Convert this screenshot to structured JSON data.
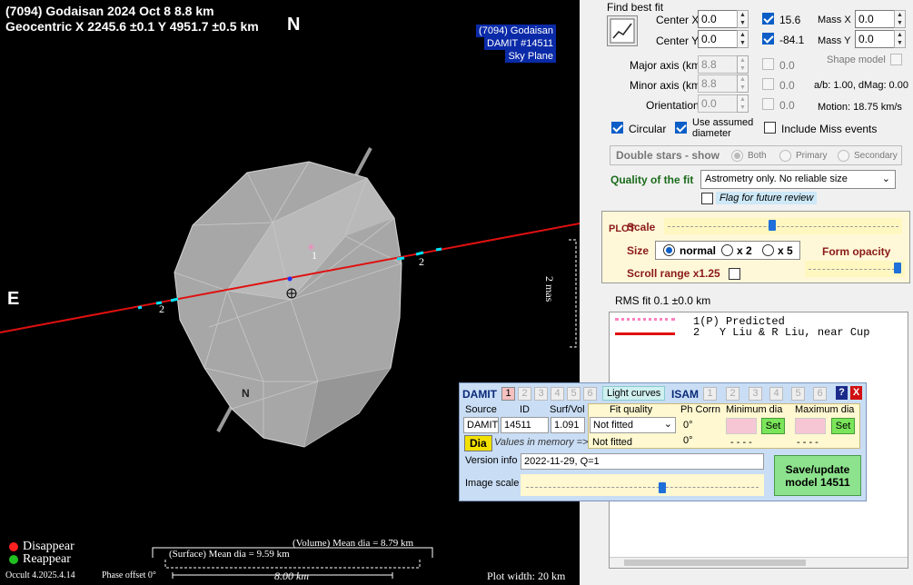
{
  "plot": {
    "title_line1": "(7094) Godaisan  2024 Oct 8   8.8 km",
    "title_line2": "Geocentric  X  2245.6 ±0.1  Y 4951.7 ±0.5 km",
    "north_label": "N",
    "east_label": "E",
    "info_name": "(7094) Godaisan",
    "info_model": "DAMIT #14511",
    "info_plane": "Sky Plane",
    "chord_label_1": "1",
    "chord_label_2a": "2",
    "chord_label_2b": "2",
    "pole_label": "N",
    "mas_label": "2 mas",
    "legend_disappear": "Disappear",
    "legend_reappear": "Reappear",
    "version": "Occult 4.2025.4.14",
    "phase_offset": "Phase offset 0°",
    "volume_mean": "(Volume) Mean dia = 8.79 km",
    "surface_mean": "(Surface) Mean dia = 9.59 km",
    "scale_bar": "8.00 km",
    "plot_width": "Plot width: 20 km",
    "colors": {
      "chord": "#e01010",
      "disappear": "#ff2020",
      "reappear": "#20c020",
      "marker": "#00e5ff"
    }
  },
  "panel": {
    "find_best_fit": "Find best fit",
    "fit_icon": "chart-fit-icon",
    "center_x_label": "Center X",
    "center_x_value": "0.0",
    "center_x_fit": "15.6",
    "center_y_label": "Center Y",
    "center_y_value": "0.0",
    "center_y_fit": "-84.1",
    "mass_x_label": "Mass X",
    "mass_x_value": "0.0",
    "mass_y_label": "Mass Y",
    "mass_y_value": "0.0",
    "shape_model_label": "Shape model",
    "major_axis_label": "Major axis (km)",
    "major_axis_value": "8.8",
    "major_axis_fit": "0.0",
    "minor_axis_label": "Minor axis (km)",
    "minor_axis_value": "8.8",
    "minor_axis_fit": "0.0",
    "ab_dmag": "a/b: 1.00, dMag: 0.00",
    "orientation_label": "Orientation",
    "orientation_value": "0.0",
    "orientation_fit": "0.0",
    "motion": "Motion: 18.75 km/s",
    "circular_label": "Circular",
    "use_assumed_label_1": "Use assumed",
    "use_assumed_label_2": "diameter",
    "include_miss_label": "Include Miss events",
    "double_stars_label": "Double stars - show",
    "ds_both": "Both",
    "ds_primary": "Primary",
    "ds_secondary": "Secondary",
    "quality_label": "Quality of the fit",
    "quality_value": "Astrometry only. No reliable size",
    "flag_label": "Flag for future review",
    "plot_vertical": "PLOT",
    "scale_label": "Scale",
    "size_label": "Size",
    "size_normal": "normal",
    "size_x2": "x 2",
    "size_x5": "x 5",
    "form_opacity_label": "Form opacity",
    "scroll_range_label": "Scroll range x1.25",
    "rms_fit": "RMS fit 0.1 ±0.0 km",
    "chord_list": [
      {
        "id": "1(P)",
        "name": "Predicted",
        "style": "dotted"
      },
      {
        "id": "2",
        "name": "Y Liu & R Liu, near Cup",
        "style": "solid"
      }
    ]
  },
  "damit": {
    "damit_label": "DAMIT",
    "tabs_left": [
      "1",
      "2",
      "3",
      "4",
      "5",
      "6"
    ],
    "light_curves_label": "Light curves",
    "isam_label": "ISAM",
    "tabs_right": [
      "1",
      "2",
      "3",
      "4",
      "5",
      "6"
    ],
    "help_label": "?",
    "close_label": "X",
    "source_label": "Source",
    "id_label": "ID",
    "surfvol_label": "Surf/Vol",
    "fit_quality_label": "Fit quality",
    "ph_corrn_label": "Ph Corrn",
    "min_dia_label": "Minimum dia",
    "max_dia_label": "Maximum dia",
    "source_value": "DAMIT",
    "id_value": "14511",
    "surfvol_value": "1.091",
    "fit_quality_value": "Not fitted",
    "ph_corrn_value": "0°",
    "set_label": "Set",
    "dia_label": "Dia",
    "values_memory": "Values in memory =>",
    "memory_fit": "Not fitted",
    "memory_phase": "0°",
    "memory_min": "- - - -",
    "memory_max": "- - - -",
    "version_info_label": "Version info",
    "version_info_value": "2022-11-29, Q=1",
    "image_scale_label": "Image scale",
    "save_label_1": "Save/update",
    "save_label_2": "model  14511"
  }
}
